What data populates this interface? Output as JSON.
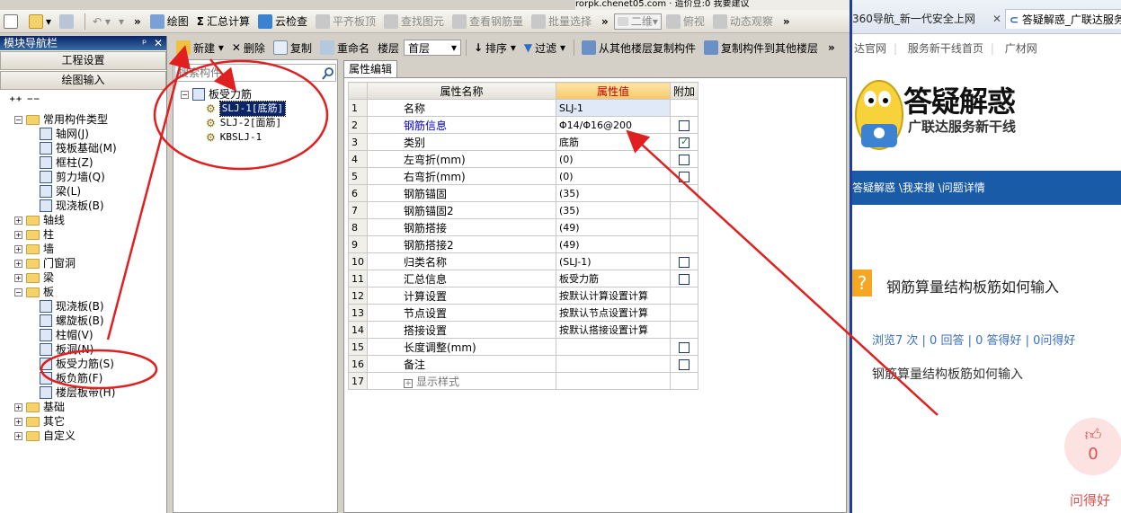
{
  "topline": "rorpk.chenet05.com · 造价豆:0  我要建议",
  "toolbar1": {
    "draw": "绘图",
    "sum": "汇总计算",
    "cloud_check": "云检查",
    "level_top": "平齐板顶",
    "find_element": "查找图元",
    "view_rebar": "查看钢筋量",
    "batch_select": "批量选择",
    "view_mode": "二维",
    "top_view": "俯视",
    "dynamic_view": "动态观察"
  },
  "toolbar2": {
    "new": "新建",
    "delete": "删除",
    "copy": "复制",
    "rename": "重命名",
    "floor_label": "楼层",
    "floor_value": "首层",
    "sort": "排序",
    "filter": "过滤",
    "copy_from": "从其他楼层复制构件",
    "copy_to": "复制构件到其他楼层"
  },
  "nav": {
    "title": "模块导航栏",
    "btn_project": "工程设置",
    "btn_draw": "绘图输入",
    "tree": [
      {
        "label": "常用构件类型",
        "type": "folder",
        "level": 0,
        "expanded": true
      },
      {
        "label": "轴网(J)",
        "type": "item",
        "level": 1
      },
      {
        "label": "筏板基础(M)",
        "type": "item",
        "level": 1
      },
      {
        "label": "框柱(Z)",
        "type": "item",
        "level": 1
      },
      {
        "label": "剪力墙(Q)",
        "type": "item",
        "level": 1
      },
      {
        "label": "梁(L)",
        "type": "item",
        "level": 1
      },
      {
        "label": "现浇板(B)",
        "type": "item",
        "level": 1
      },
      {
        "label": "轴线",
        "type": "folder",
        "level": 0
      },
      {
        "label": "柱",
        "type": "folder",
        "level": 0
      },
      {
        "label": "墙",
        "type": "folder",
        "level": 0
      },
      {
        "label": "门窗洞",
        "type": "folder",
        "level": 0
      },
      {
        "label": "梁",
        "type": "folder",
        "level": 0
      },
      {
        "label": "板",
        "type": "folder",
        "level": 0,
        "expanded": true
      },
      {
        "label": "现浇板(B)",
        "type": "item",
        "level": 1
      },
      {
        "label": "螺旋板(B)",
        "type": "item",
        "level": 1
      },
      {
        "label": "柱帽(V)",
        "type": "item",
        "level": 1
      },
      {
        "label": "板洞(N)",
        "type": "item",
        "level": 1
      },
      {
        "label": "板受力筋(S)",
        "type": "item",
        "level": 1
      },
      {
        "label": "板负筋(F)",
        "type": "item",
        "level": 1
      },
      {
        "label": "楼层板带(H)",
        "type": "item",
        "level": 1
      },
      {
        "label": "基础",
        "type": "folder",
        "level": 0
      },
      {
        "label": "其它",
        "type": "folder",
        "level": 0
      },
      {
        "label": "自定义",
        "type": "folder",
        "level": 0
      }
    ]
  },
  "component_list": {
    "search_placeholder": "搜索构件...",
    "root": "板受力筋",
    "items": [
      "SLJ-1[底筋]",
      "SLJ-2[面筋]",
      "KBSLJ-1"
    ]
  },
  "property_tab": "属性编辑",
  "property_grid": {
    "headers": [
      "属性名称",
      "属性值",
      "附加"
    ],
    "rows": [
      {
        "no": "1",
        "name": "名称",
        "value": "SLJ-1",
        "blue": false,
        "check": null
      },
      {
        "no": "2",
        "name": "钢筋信息",
        "value": "Φ14/Φ16@200",
        "blue": true,
        "check": false
      },
      {
        "no": "3",
        "name": "类别",
        "value": "底筋",
        "blue": false,
        "check": true
      },
      {
        "no": "4",
        "name": "左弯折(mm)",
        "value": "(0)",
        "blue": false,
        "check": false
      },
      {
        "no": "5",
        "name": "右弯折(mm)",
        "value": "(0)",
        "blue": false,
        "check": false
      },
      {
        "no": "6",
        "name": "钢筋锚固",
        "value": "(35)",
        "blue": false,
        "check": null
      },
      {
        "no": "7",
        "name": "钢筋锚固2",
        "value": "(35)",
        "blue": false,
        "check": null
      },
      {
        "no": "8",
        "name": "钢筋搭接",
        "value": "(49)",
        "blue": false,
        "check": null
      },
      {
        "no": "9",
        "name": "钢筋搭接2",
        "value": "(49)",
        "blue": false,
        "check": null
      },
      {
        "no": "10",
        "name": "归类名称",
        "value": "(SLJ-1)",
        "blue": false,
        "check": false
      },
      {
        "no": "11",
        "name": "汇总信息",
        "value": "板受力筋",
        "blue": false,
        "check": false
      },
      {
        "no": "12",
        "name": "计算设置",
        "value": "按默认计算设置计算",
        "blue": false,
        "check": null
      },
      {
        "no": "13",
        "name": "节点设置",
        "value": "按默认节点设置计算",
        "blue": false,
        "check": null
      },
      {
        "no": "14",
        "name": "搭接设置",
        "value": "按默认搭接设置计算",
        "blue": false,
        "check": null
      },
      {
        "no": "15",
        "name": "长度调整(mm)",
        "value": "",
        "blue": false,
        "check": false
      },
      {
        "no": "16",
        "name": "备注",
        "value": "",
        "blue": false,
        "check": false
      },
      {
        "no": "17",
        "name": "显示样式",
        "value": "",
        "blue": false,
        "check": null,
        "expandable": true
      }
    ]
  },
  "browser": {
    "tab1": "360导航_新一代安全上网",
    "tab2": "答疑解惑_广联达服务",
    "links": [
      "达官网",
      "服务新干线首页",
      "广材网"
    ],
    "banner_title": "答疑解惑",
    "banner_sub": "广联达服务新干线",
    "crumb": "答疑解惑 \\我来搜 \\问题详情",
    "question": "钢筋算量结构板筋如何输入",
    "stats": "浏览7 次 | 0 回答 | 0 答得好 | 0问得好",
    "body": "钢筋算量结构板筋如何输入",
    "like_count": "0",
    "like_label": "问得好"
  },
  "colors": {
    "accent_blue": "#1a5ba8",
    "annotation_red": "#e02020",
    "grid_header_orange": "#f6c76b"
  }
}
